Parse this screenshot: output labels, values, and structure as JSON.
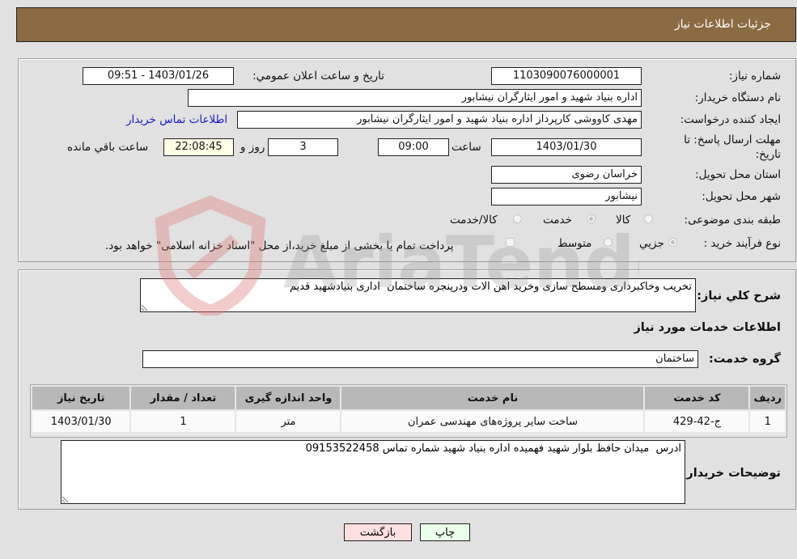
{
  "header": {
    "title": "جزئیات اطلاعات نیاز"
  },
  "details": {
    "need_number_label": "شماره نیاز:",
    "need_number": "1103090076000001",
    "announce_label": "تاریخ و ساعت اعلان عمومي:",
    "announce_value": "1403/01/26 - 09:51",
    "buyer_org_label": "نام دستگاه خریدار:",
    "buyer_org": "اداره بنیاد شهید و امور ایثارگران نیشابور",
    "creator_label": "ایجاد کننده درخواست:",
    "creator": "مهدی کاووشی کارپرداز اداره بنیاد شهید و امور ایثارگران نیشابور",
    "buyer_contact_link": "اطلاعات تماس خریدار",
    "deadline_label": "مهلت ارسال پاسخ: تا تاریخ:",
    "deadline_date": "1403/01/30",
    "time_label": "ساعت",
    "deadline_time": "09:00",
    "days_value": "3",
    "days_label": "روز و",
    "remaining_time": "22:08:45",
    "remaining_label": "ساعت باقي مانده",
    "province_label": "استان محل تحویل:",
    "province": "خراسان رضوی",
    "city_label": "شهر محل تحویل:",
    "city": "نیشابور",
    "category_label": "طبقه بندی موضوعی:",
    "category_options": [
      {
        "label": "کالا",
        "checked": false
      },
      {
        "label": "خدمت",
        "checked": true
      },
      {
        "label": "کالا/خدمت",
        "checked": false
      }
    ],
    "process_label": "نوع فرآیند خرید :",
    "process_options": [
      {
        "label": "جزیي",
        "checked": true
      },
      {
        "label": "متوسط",
        "checked": false
      }
    ],
    "treasury_note": "پرداخت تمام یا بخشی از مبلغ خرید،از محل \"اسناد خزانه اسلامی\" خواهد بود."
  },
  "general": {
    "description_label": "شرح كلي نياز:",
    "description": "تخریب وخاکبرداری ومسطح سازی وخرید اهن الات ودرپنجره ساختمان  اداری بنیادشهید قدیم",
    "services_heading": "اطلاعات خدمات مورد نیاز",
    "service_group_label": "گروه خدمت:",
    "service_group": "ساختمان",
    "table": {
      "headers": [
        "ردیف",
        "کد خدمت",
        "نام خدمت",
        "واحد اندازه گیری",
        "تعداد / مقدار",
        "تاریخ نیاز"
      ],
      "rows": [
        [
          "1",
          "ج-42-429",
          "ساخت سایر پروژه‌های مهندسی عمران",
          "متر",
          "1",
          "1403/01/30"
        ]
      ]
    },
    "buyer_notes_label": "توضیحات خریدار:",
    "buyer_notes": "ادرس  میدان حافظ بلوار شهید فهمیده اداره بنیاد شهید شماره تماس 09153522458"
  },
  "buttons": {
    "print": "چاپ",
    "back": "بازگشت"
  },
  "colors": {
    "header_bg": "#8b6b42",
    "print_bg": "#eaffea",
    "back_bg": "#ffe0e0",
    "remaining_bg": "#ffffe6",
    "link": "#1a1acc"
  },
  "watermark": {
    "text": "AriaTender.neT"
  }
}
